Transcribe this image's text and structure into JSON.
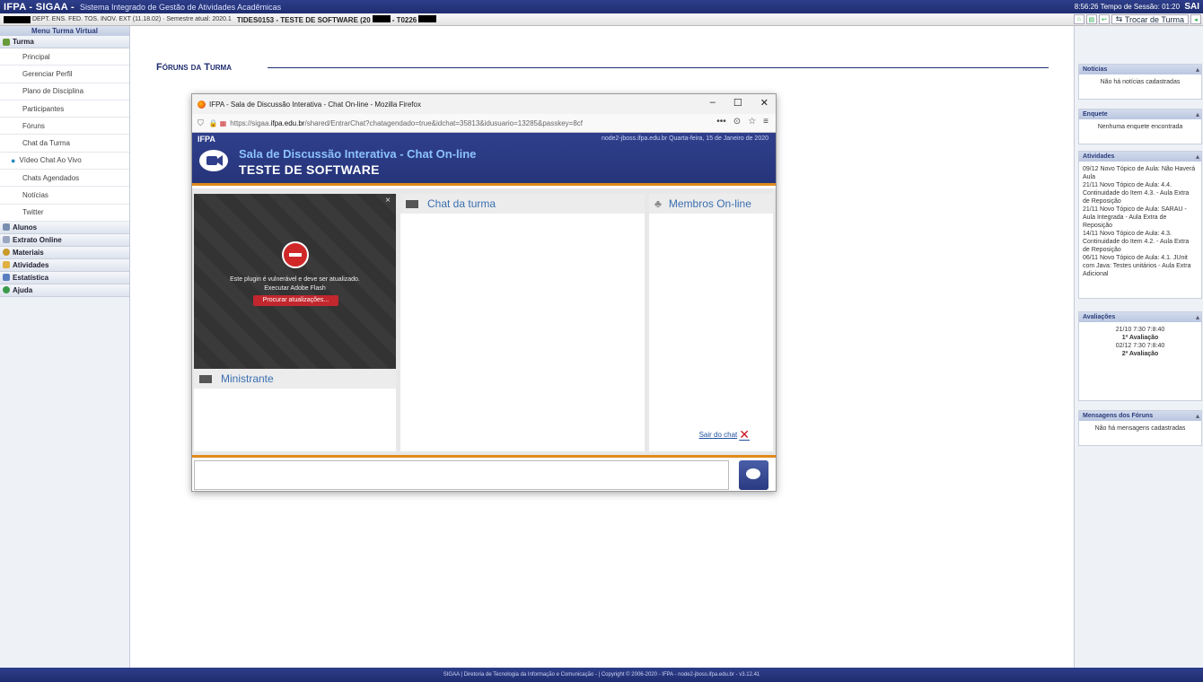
{
  "topbar": {
    "brand": "IFPA - SIGAA -",
    "system_name": "Sistema Integrado de Gestão de Atividades Acadêmicas",
    "session_time": "8:56:26",
    "session_label": "Tempo de Sessão: 01:20",
    "sair": "SAI",
    "dept_info": "DEPT. ENS. FED. TOS. INOV. EXT (11.18.02) · Semestre atual: 2020.1",
    "course": "TIDES0153 - TESTE DE SOFTWARE (20",
    "course_suffix": "- T0226",
    "trocar_turma": "Trocar de Turma"
  },
  "leftmenu": {
    "title": "Menu Turma Virtual",
    "groups": [
      {
        "label": "Turma"
      },
      {
        "label": "Alunos"
      },
      {
        "label": "Extrato Online"
      },
      {
        "label": "Materiais"
      },
      {
        "label": "Atividades"
      },
      {
        "label": "Estatística"
      },
      {
        "label": "Ajuda"
      }
    ],
    "turma_items": [
      "Principal",
      "Gerenciar Perfil",
      "Plano de Disciplina",
      "Participantes",
      "Fóruns",
      "Chat da Turma",
      "Vídeo Chat Ao Vivo",
      "Chats Agendados",
      "Notícias",
      "Twitter"
    ]
  },
  "main": {
    "section_title": "Fóruns da Turma"
  },
  "rightbar": {
    "noticias": {
      "title": "Notícias",
      "text": "Não há notícias cadastradas"
    },
    "enquete": {
      "title": "Enquete",
      "text": "Nenhuma enquete encontrada"
    },
    "atividades": {
      "title": "Atividades",
      "items": [
        "09/12 Novo Tópico de Aula: Não Haverá Aula",
        "21/11 Novo Tópico de Aula: 4.4. Continuidade do Item 4.3. - Aula Extra de Reposição",
        "21/11 Novo Tópico de Aula: SARAU - Aula Integrada - Aula Extra de Reposição",
        "14/11 Novo Tópico de Aula: 4.3. Continuidade do Item 4.2. - Aula Extra de Reposição",
        "06/11 Novo Tópico de Aula: 4.1. JUnit com Java: Testes unitários - Aula Extra Adicional"
      ]
    },
    "avaliacoes": {
      "title": "Avaliações",
      "items": [
        "21/10 7:30 7:8:40",
        "1ª Avaliação",
        "02/12 7:30 7:8:40",
        "2ª Avaliação"
      ]
    },
    "mensagens": {
      "title": "Mensagens dos Fóruns",
      "text": "Não há mensagens cadastradas"
    }
  },
  "footer": {
    "text": "SIGAA | Diretoria de Tecnologia da Informação e Comunicação - | Copyright © 2006-2020 - IFPA - node2-jboss.ifpa.edu.br - v3.12.41"
  },
  "popup": {
    "window_title": "IFPA - Sala de Discussão Interativa - Chat On-line - Mozilla Firefox",
    "url_prefix": "https://sigaa.",
    "url_domain": "ifpa.edu.br",
    "url_rest": "/shared/EntrarChat?chatagendado=true&idchat=35813&idusuario=13285&passkey=8cf",
    "ifpa": "IFPA",
    "date_info": "node2-jboss.ifpa.edu.br    Quarta-feira, 15 de Janeiro de 2020",
    "sala": "Sala de Discussão Interativa - Chat On-line",
    "turma": "TESTE DE SOFTWARE",
    "flash_msg1": "Este plugin é vulnerável e deve ser atualizado.",
    "flash_msg2": "Executar Adobe Flash",
    "flash_btn": "Procurar atualizações...",
    "ministrante": "Ministrante",
    "chat_turma": "Chat da turma",
    "membros": "Membros On-line",
    "sair_chat": "Sair do chat"
  }
}
